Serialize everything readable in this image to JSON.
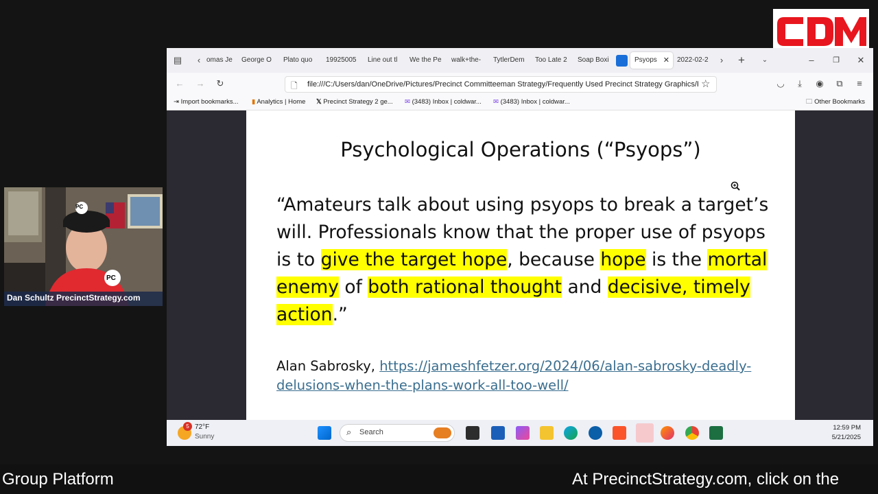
{
  "logo": {
    "text": "CDM",
    "color": "#e8161e"
  },
  "webcam": {
    "name_label": "Dan Schultz PrecinctStrategy.com",
    "cap_badge": "PC",
    "shirt_badge": "PC"
  },
  "browser": {
    "tabs": [
      "omas Je",
      "George O",
      "Plato quo",
      "19925005",
      "Line out tl",
      "We the Pe",
      "walk+the-",
      "TytlerDem",
      "Too Late 2",
      "Soap Boxi",
      "Psyops",
      "2022-02-2"
    ],
    "active_tab": "Psyops",
    "url": "file:///C:/Users/dan/OneDrive/Pictures/Precinct Committeeman Strategy/Frequently Used Precinct Strategy Graphics/P",
    "bookmarks": [
      "Import bookmarks...",
      "Analytics | Home",
      "Precinct Strategy 2 ge...",
      "(3483) Inbox | coldwar...",
      "(3483) Inbox | coldwar..."
    ],
    "other_bookmarks": "Other Bookmarks"
  },
  "slide": {
    "title": "Psychological Operations (“Psyops”)",
    "quote": {
      "p1": "“Amateurs talk about using psyops to break a target’s will. Professionals know that the proper use of psyops is to ",
      "h1": "give the target hope",
      "p2": ", because ",
      "h2": "hope",
      "p3": " is the ",
      "h3": "mortal enemy",
      "p4": " of ",
      "h4": "both rational thought",
      "p5": " and ",
      "h5": "decisive, timely action",
      "p6": ".”"
    },
    "author": "Alan Sabrosky, ",
    "link": "https://jameshfetzer.org/2024/06/alan-sabrosky-deadly-delusions-when-the-plans-work-all-too-well/"
  },
  "taskbar": {
    "weather_temp": "72°F",
    "weather_desc": "Sunny",
    "weather_badge": "5",
    "search_label": "Search",
    "time": "12:59 PM",
    "date": "5/21/2025"
  },
  "ticker": {
    "left": "Group Platform",
    "right": "At PrecinctStrategy.com, click on the"
  }
}
